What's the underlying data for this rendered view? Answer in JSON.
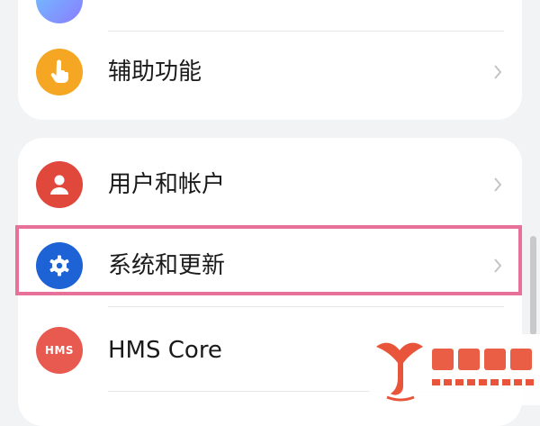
{
  "settings": {
    "items": [
      {
        "id": "accessibility",
        "label": "辅助功能",
        "icon": "hand-pointer-icon",
        "color": "#f5a623"
      },
      {
        "id": "users-accounts",
        "label": "用户和帐户",
        "icon": "person-icon",
        "color": "#e0483c"
      },
      {
        "id": "system-updates",
        "label": "系统和更新",
        "icon": "gear-icon",
        "color": "#1e63d6"
      },
      {
        "id": "hms-core",
        "label": "HMS Core",
        "icon": "hms-icon",
        "icon_text": "HMS",
        "color": "#e85a4f"
      }
    ]
  },
  "highlight": {
    "target": "system-updates",
    "color": "#e8719a"
  },
  "watermark": {
    "title": "赛玖百科",
    "subtitle": "SAIJIUBAIKE",
    "color": "#e8553a"
  }
}
